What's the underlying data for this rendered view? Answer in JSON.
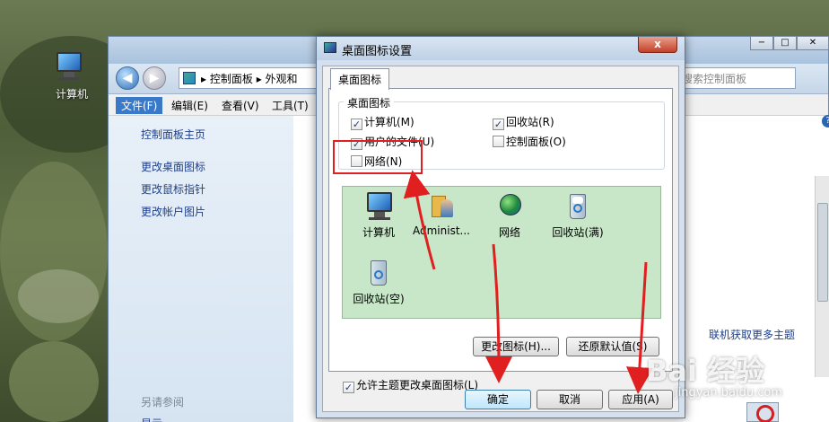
{
  "desktop": {
    "icon_label": "计算机"
  },
  "control_panel": {
    "address_path": [
      "控制面板",
      "外观和"
    ],
    "search_placeholder": "搜索控制面板",
    "menu": [
      "文件(F)",
      "编辑(E)",
      "查看(V)",
      "工具(T)"
    ],
    "sidebar_links": [
      "控制面板主页",
      "更改桌面图标",
      "更改鼠标指针",
      "更改帐户图片"
    ],
    "see_also_header": "另请参阅",
    "see_also_partial": "显示",
    "online_link": "联机获取更多主题"
  },
  "dialog": {
    "title": "桌面图标设置",
    "close_label": "x",
    "tab": "桌面图标",
    "group_title": "桌面图标",
    "checkboxes": [
      {
        "label": "计算机(M)",
        "checked": true
      },
      {
        "label": "回收站(R)",
        "checked": true
      },
      {
        "label": "用户的文件(U)",
        "checked": true
      },
      {
        "label": "控制面板(O)",
        "checked": false
      },
      {
        "label": "网络(N)",
        "checked": false
      }
    ],
    "icons": [
      "计算机",
      "Administ...",
      "网络",
      "回收站(满)",
      "回收站(空)"
    ],
    "change_icon_button": "更改图标(H)...",
    "restore_default_button": "还原默认值(S)",
    "allow_themes_checkbox": {
      "label": "允许主题更改桌面图标(L)",
      "checked": true
    },
    "ok_button": "确定",
    "cancel_button": "取消",
    "apply_button": "应用(A)"
  },
  "annotations": {
    "watermark": "Bai 经验",
    "watermark_url": "jingyan.baidu.com"
  },
  "colors": {
    "accent": "#3a78c8",
    "annotation_red": "#e02020",
    "icon_list_bg": "#c8e6c8"
  }
}
